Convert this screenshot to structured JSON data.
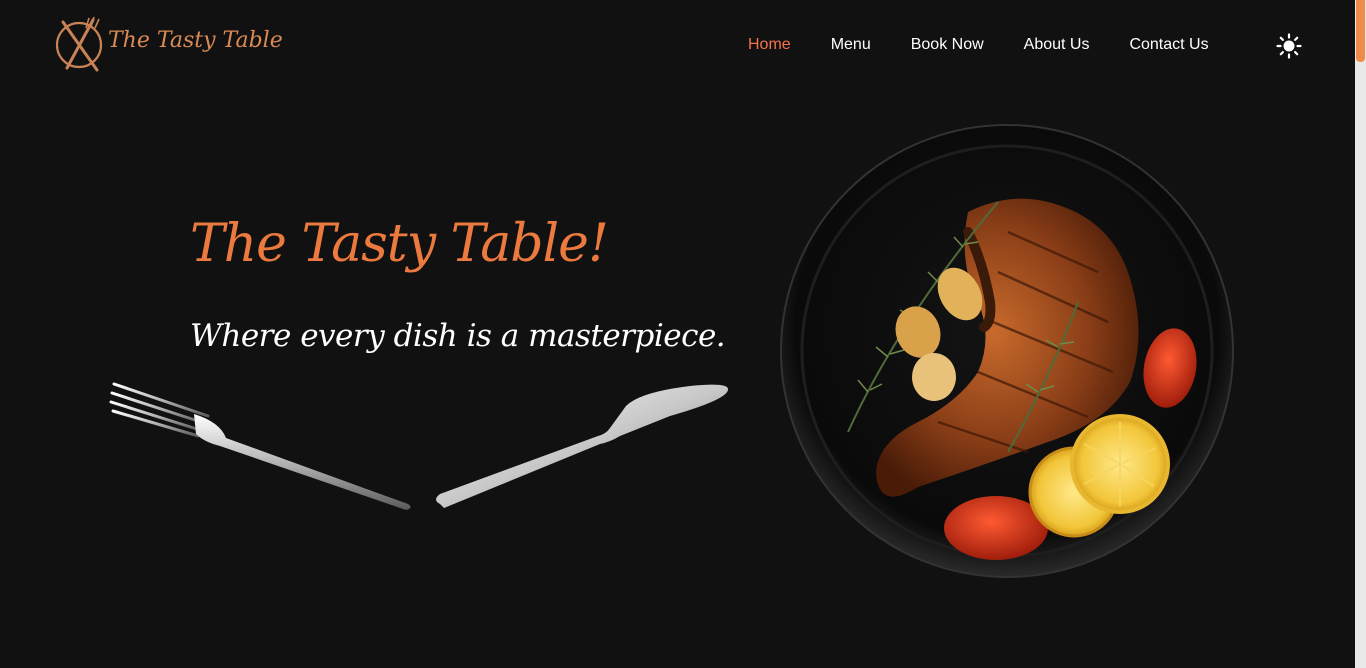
{
  "brand": {
    "logo_text": "The Tasty Table"
  },
  "nav": {
    "items": [
      {
        "label": "Home",
        "active": true
      },
      {
        "label": "Menu",
        "active": false
      },
      {
        "label": "Book Now",
        "active": false
      },
      {
        "label": "About Us",
        "active": false
      },
      {
        "label": "Contact Us",
        "active": false
      }
    ],
    "theme_toggle_icon": "sun-icon"
  },
  "hero": {
    "title": "The Tasty Table!",
    "tagline": "Where every dish is a masterpiece."
  },
  "colors": {
    "background": "#111111",
    "accent": "#f3734b",
    "title": "#ec7a3f",
    "logo": "#d98a55",
    "text": "#ffffff"
  }
}
